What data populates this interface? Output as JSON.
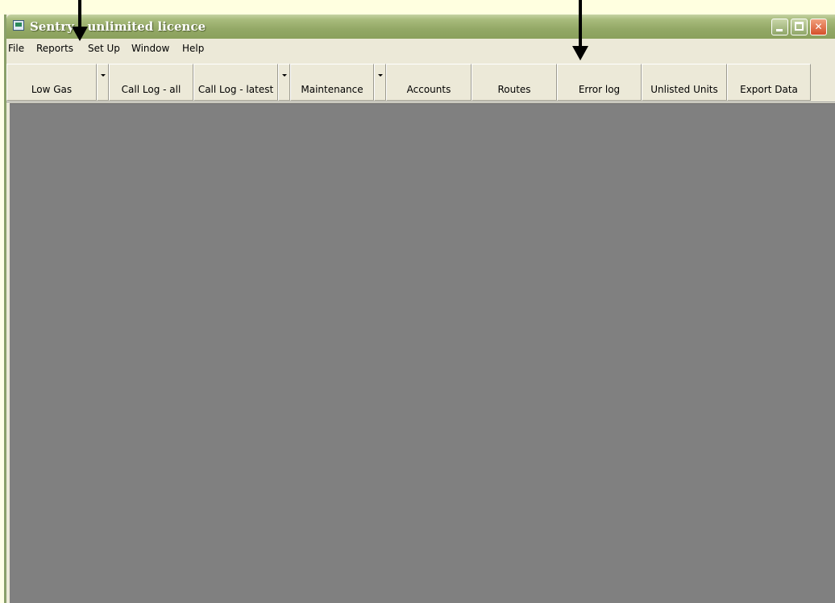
{
  "window": {
    "title": "Sentry - unlimited licence"
  },
  "menu": [
    "File",
    "Reports",
    "Set Up",
    "Window",
    "Help"
  ],
  "toolbar": {
    "buttons": [
      "Low Gas",
      "Call Log - all",
      "Call Log - latest",
      "Maintenance",
      "Accounts",
      "Routes",
      "Error log",
      "Unlisted Units",
      "Export Data"
    ]
  },
  "colors": {
    "titlebar": "#93a866",
    "chrome": "#ece9d8",
    "mdi_client": "#808080",
    "annotation_arrow": "#000000"
  }
}
